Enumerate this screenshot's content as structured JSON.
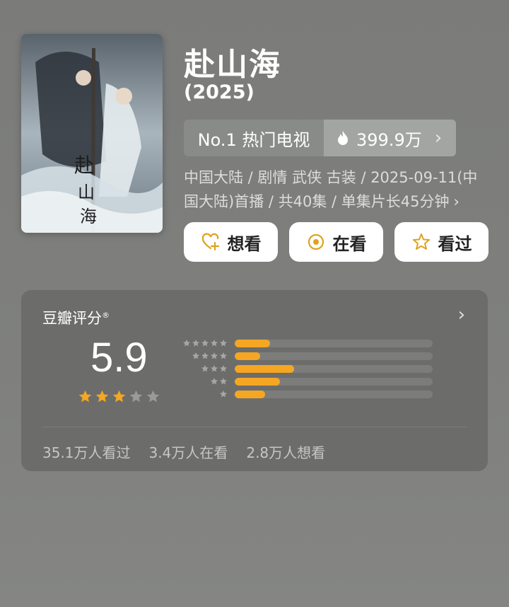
{
  "show": {
    "title": "赴山海",
    "year": "(2025)",
    "rank_label": "No.1 热门电视",
    "heat_value": "399.9万",
    "meta_line": "中国大陆 / 剧情 武侠 古装 / 2025-09-11(中国大陆)首播 / 共40集 / 单集片长45分钟",
    "meta_chevron": "›"
  },
  "actions": {
    "want_label": "想看",
    "watching_label": "在看",
    "watched_label": "看过"
  },
  "rating": {
    "header": "豆瓣评分",
    "header_mark": "®",
    "score": "5.9",
    "stars_filled": 3,
    "stars_total": 5,
    "distribution": [
      {
        "stars": 5,
        "fraction": 0.18
      },
      {
        "stars": 4,
        "fraction": 0.13
      },
      {
        "stars": 3,
        "fraction": 0.3
      },
      {
        "stars": 2,
        "fraction": 0.23
      },
      {
        "stars": 1,
        "fraction": 0.155
      }
    ],
    "stats": {
      "watched": "35.1万人看过",
      "watching": "3.4万人在看",
      "want": "2.8万人想看"
    }
  },
  "colors": {
    "accent": "#f5a623",
    "card_bg": "#6c6d6b",
    "page_bg": "#7d7e7c"
  },
  "icons": {
    "heat": "fire-icon",
    "want": "heart-plus-icon",
    "watching": "target-icon",
    "watched": "star-outline-icon"
  }
}
